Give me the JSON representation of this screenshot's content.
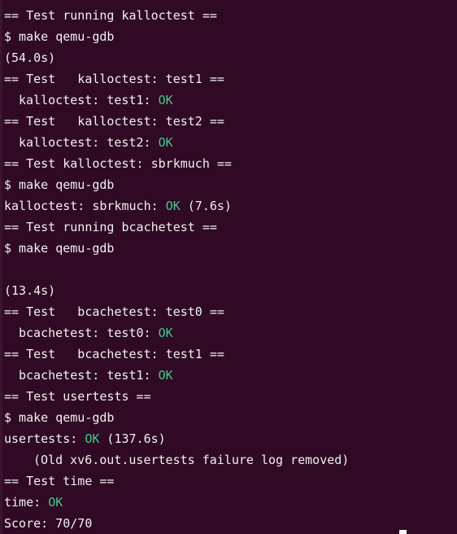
{
  "terminal": {
    "lines": {
      "l01": "== Test running kalloctest ==",
      "l02": "$ make qemu-gdb",
      "l03": "(54.0s)",
      "l04": "== Test   kalloctest: test1 ==",
      "l05_pre": "kalloctest: test1: ",
      "l05_ok": "OK",
      "l06": "== Test   kalloctest: test2 ==",
      "l07_pre": "kalloctest: test2: ",
      "l07_ok": "OK",
      "l08": "== Test kalloctest: sbrkmuch ==",
      "l09": "$ make qemu-gdb",
      "l10_pre": "kalloctest: sbrkmuch: ",
      "l10_ok": "OK",
      "l10_post": " (7.6s)",
      "l11": "== Test running bcachetest ==",
      "l12": "$ make qemu-gdb",
      "l13": "",
      "l14": "(13.4s)",
      "l15": "== Test   bcachetest: test0 ==",
      "l16_pre": "bcachetest: test0: ",
      "l16_ok": "OK",
      "l17": "== Test   bcachetest: test1 ==",
      "l18_pre": "bcachetest: test1: ",
      "l18_ok": "OK",
      "l19": "== Test usertests ==",
      "l20": "$ make qemu-gdb",
      "l21_pre": "usertests: ",
      "l21_ok": "OK",
      "l21_post": " (137.6s)",
      "l22": "(Old xv6.out.usertests failure log removed)",
      "l23": "== Test time ==",
      "l24_pre": "time: ",
      "l24_ok": "OK",
      "l25": "Score: 70/70"
    },
    "colors": {
      "background": "#300a24",
      "text": "#f0f0f0",
      "ok": "#43c98a"
    }
  }
}
